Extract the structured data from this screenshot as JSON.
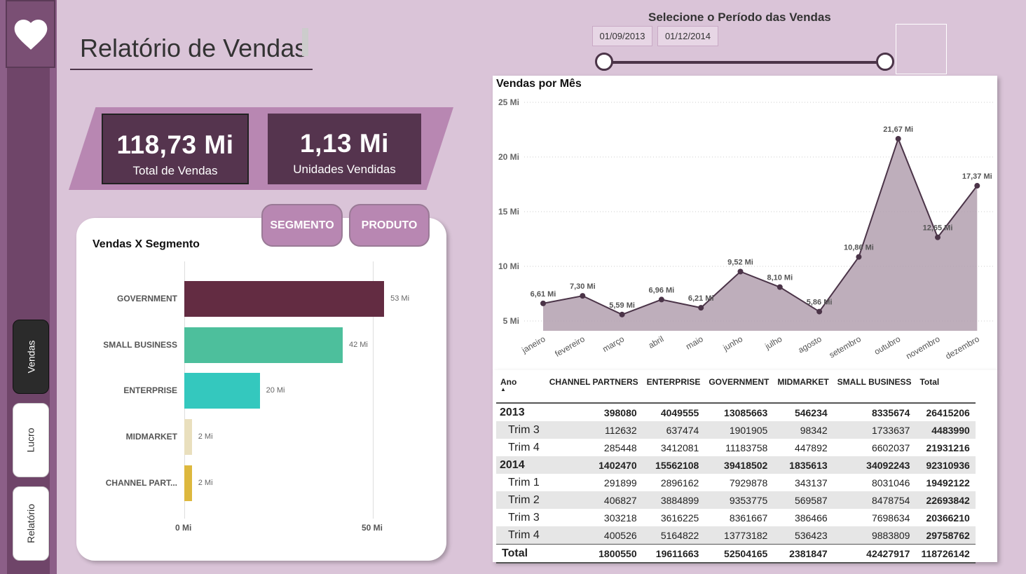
{
  "sidebar": {
    "nav": [
      {
        "label": "Vendas"
      },
      {
        "label": "Lucro"
      },
      {
        "label": "Relatório"
      }
    ],
    "logo_icon": "heart-icon"
  },
  "header": {
    "title": "Relatório de Vendas"
  },
  "kpis": [
    {
      "value": "118,73 Mi",
      "label": "Total de Vendas"
    },
    {
      "value": "1,13 Mi",
      "label": "Unidades Vendidas"
    }
  ],
  "segment_card": {
    "title": "Vendas X Segmento",
    "buttons": {
      "segment": "SEGMENTO",
      "product": "PRODUTO"
    },
    "bars": [
      {
        "category": "GOVERNMENT",
        "label": "53 Mi",
        "value": 53,
        "color": "#632c42"
      },
      {
        "category": "SMALL BUSINESS",
        "label": "42 Mi",
        "value": 42,
        "color": "#4dbf9c"
      },
      {
        "category": "ENTERPRISE",
        "label": "20 Mi",
        "value": 20,
        "color": "#34c8be"
      },
      {
        "category": "MIDMARKET",
        "label": "2 Mi",
        "value": 2,
        "color": "#e9dfbd"
      },
      {
        "category": "CHANNEL PART...",
        "label": "2 Mi",
        "value": 2,
        "color": "#ddb83e"
      }
    ],
    "axis": [
      "0 Mi",
      "50 Mi"
    ]
  },
  "slicer": {
    "title": "Selecione o Período das Vendas",
    "start": "01/09/2013",
    "end": "01/12/2014"
  },
  "chart_data": {
    "type": "area",
    "title": "Vendas por Mês",
    "categories": [
      "janeiro",
      "fevereiro",
      "março",
      "abril",
      "maio",
      "junho",
      "julho",
      "agosto",
      "setembro",
      "outubro",
      "novembro",
      "dezembro"
    ],
    "values": [
      6.61,
      7.3,
      5.59,
      6.96,
      6.21,
      9.52,
      8.1,
      5.86,
      10.86,
      21.67,
      12.65,
      17.37
    ],
    "data_labels": [
      "6,61 Mi",
      "7,30 Mi",
      "5,59 Mi",
      "6,96 Mi",
      "6,21 Mi",
      "9,52 Mi",
      "8,10 Mi",
      "5,86 Mi",
      "10,86 Mi",
      "21,67 Mi",
      "12,65 Mi",
      "17,37 Mi"
    ],
    "y_ticks": [
      "5 Mi",
      "10 Mi",
      "15 Mi",
      "20 Mi",
      "25 Mi"
    ],
    "y_tick_values": [
      5,
      10,
      15,
      20,
      25
    ],
    "ylim": [
      4,
      25
    ],
    "grid": true,
    "line_color": "#4b3448",
    "fill_color": "#b3a0af"
  },
  "matrix": {
    "headers": [
      "Ano",
      "CHANNEL PARTNERS",
      "ENTERPRISE",
      "GOVERNMENT",
      "MIDMARKET",
      "SMALL BUSINESS",
      "Total"
    ],
    "rows": [
      {
        "kind": "year",
        "cells": [
          "2013",
          "398080",
          "4049555",
          "13085663",
          "546234",
          "8335674",
          "26415206"
        ]
      },
      {
        "kind": "sub",
        "cells": [
          "Trim 3",
          "112632",
          "637474",
          "1901905",
          "98342",
          "1733637",
          "4483990"
        ]
      },
      {
        "kind": "sub",
        "cells": [
          "Trim 4",
          "285448",
          "3412081",
          "11183758",
          "447892",
          "6602037",
          "21931216"
        ]
      },
      {
        "kind": "year",
        "cells": [
          "2014",
          "1402470",
          "15562108",
          "39418502",
          "1835613",
          "34092243",
          "92310936"
        ]
      },
      {
        "kind": "sub",
        "cells": [
          "Trim 1",
          "291899",
          "2896162",
          "7929878",
          "343137",
          "8031046",
          "19492122"
        ]
      },
      {
        "kind": "sub",
        "cells": [
          "Trim 2",
          "406827",
          "3884899",
          "9353775",
          "569587",
          "8478754",
          "22693842"
        ]
      },
      {
        "kind": "sub",
        "cells": [
          "Trim 3",
          "303218",
          "3616225",
          "8361667",
          "386466",
          "7698634",
          "20366210"
        ]
      },
      {
        "kind": "sub",
        "cells": [
          "Trim 4",
          "400526",
          "5164822",
          "13773182",
          "536423",
          "9883809",
          "29758762"
        ]
      },
      {
        "kind": "total",
        "cells": [
          "Total",
          "1800550",
          "19611663",
          "52504165",
          "2381847",
          "42427917",
          "118726142"
        ]
      }
    ]
  }
}
